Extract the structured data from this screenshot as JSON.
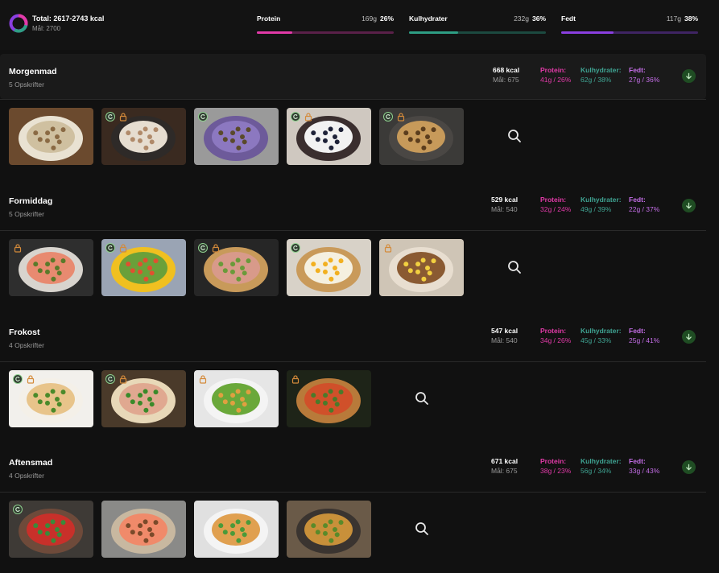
{
  "summary": {
    "total": "Total: 2617-2743 kcal",
    "goal": "Mål: 2700",
    "macros": [
      {
        "label": "Protein",
        "grams": "169g",
        "percent": "26%",
        "color": "#e23aa8",
        "track": "#5a2049",
        "fraction": 0.26
      },
      {
        "label": "Kulhydrater",
        "grams": "232g",
        "percent": "36%",
        "color": "#2e9e84",
        "track": "#1c4a40",
        "fraction": 0.36
      },
      {
        "label": "Fedt",
        "grams": "117g",
        "percent": "38%",
        "color": "#8a3fe0",
        "track": "#3f2463",
        "fraction": 0.38
      }
    ]
  },
  "meals": [
    {
      "name": "Morgenmad",
      "count": "5 Opskrifter",
      "kcal": "668 kcal",
      "goal": "Mål: 675",
      "protein_label": "Protein:",
      "protein_value": "41g / 26%",
      "carb_label": "Kulhydrater:",
      "carb_value": "62g / 38%",
      "fat_label": "Fedt:",
      "fat_value": "27g / 36%",
      "expanded": true,
      "recipes": [
        {
          "icon": "oatmeal-bowl-image",
          "badges": []
        },
        {
          "icon": "porridge-bowl-image",
          "badges": [
            "swap",
            "lock"
          ]
        },
        {
          "icon": "berry-smoothie-image",
          "badges": [
            "swap"
          ]
        },
        {
          "icon": "yogurt-blueberries-image",
          "badges": [
            "swap",
            "lock"
          ]
        },
        {
          "icon": "seeded-bun-image",
          "badges": [
            "swap",
            "lock"
          ]
        }
      ]
    },
    {
      "name": "Formiddag",
      "count": "5 Opskrifter",
      "kcal": "529 kcal",
      "goal": "Mål: 540",
      "protein_label": "Protein:",
      "protein_value": "32g / 24%",
      "carb_label": "Kulhydrater:",
      "carb_value": "49g / 39%",
      "fat_label": "Fedt:",
      "fat_value": "22g / 37%",
      "expanded": false,
      "recipes": [
        {
          "icon": "salmon-rye-bread-image",
          "badges": [
            "lock"
          ]
        },
        {
          "icon": "lunchbox-snack-image",
          "badges": [
            "swap",
            "lock"
          ]
        },
        {
          "icon": "tuna-avocado-toast-image",
          "badges": [
            "swap",
            "lock"
          ]
        },
        {
          "icon": "egg-avocado-toast-image",
          "badges": [
            "swap"
          ]
        },
        {
          "icon": "banana-bread-image",
          "badges": [
            "lock"
          ]
        }
      ]
    },
    {
      "name": "Frokost",
      "count": "4 Opskrifter",
      "kcal": "547 kcal",
      "goal": "Mål: 540",
      "protein_label": "Protein:",
      "protein_value": "34g / 26%",
      "carb_label": "Kulhydrater:",
      "carb_value": "45g / 33%",
      "fat_label": "Fedt:",
      "fat_value": "25g / 41%",
      "expanded": false,
      "recipes": [
        {
          "icon": "pita-bread-image",
          "badges": [
            "swap",
            "lock"
          ]
        },
        {
          "icon": "club-sandwich-image",
          "badges": [
            "swap",
            "lock"
          ]
        },
        {
          "icon": "chicken-salad-image",
          "badges": [
            "lock"
          ]
        },
        {
          "icon": "bruschetta-image",
          "badges": [
            "lock"
          ]
        }
      ]
    },
    {
      "name": "Aftensmad",
      "count": "4 Opskrifter",
      "kcal": "671 kcal",
      "goal": "Mål: 675",
      "protein_label": "Protein:",
      "protein_value": "38g / 23%",
      "carb_label": "Kulhydrater:",
      "carb_value": "56g / 34%",
      "fat_label": "Fedt:",
      "fat_value": "33g / 43%",
      "expanded": false,
      "recipes": [
        {
          "icon": "greek-salad-image",
          "badges": [
            "swap"
          ]
        },
        {
          "icon": "salmon-bagel-image",
          "badges": []
        },
        {
          "icon": "grilled-chicken-salad-image",
          "badges": []
        },
        {
          "icon": "fried-rice-image",
          "badges": []
        }
      ]
    }
  ],
  "icons": {
    "search": "search-icon",
    "toggle": "arrow-down-icon",
    "swap": "swap-icon",
    "lock": "lock-icon"
  }
}
